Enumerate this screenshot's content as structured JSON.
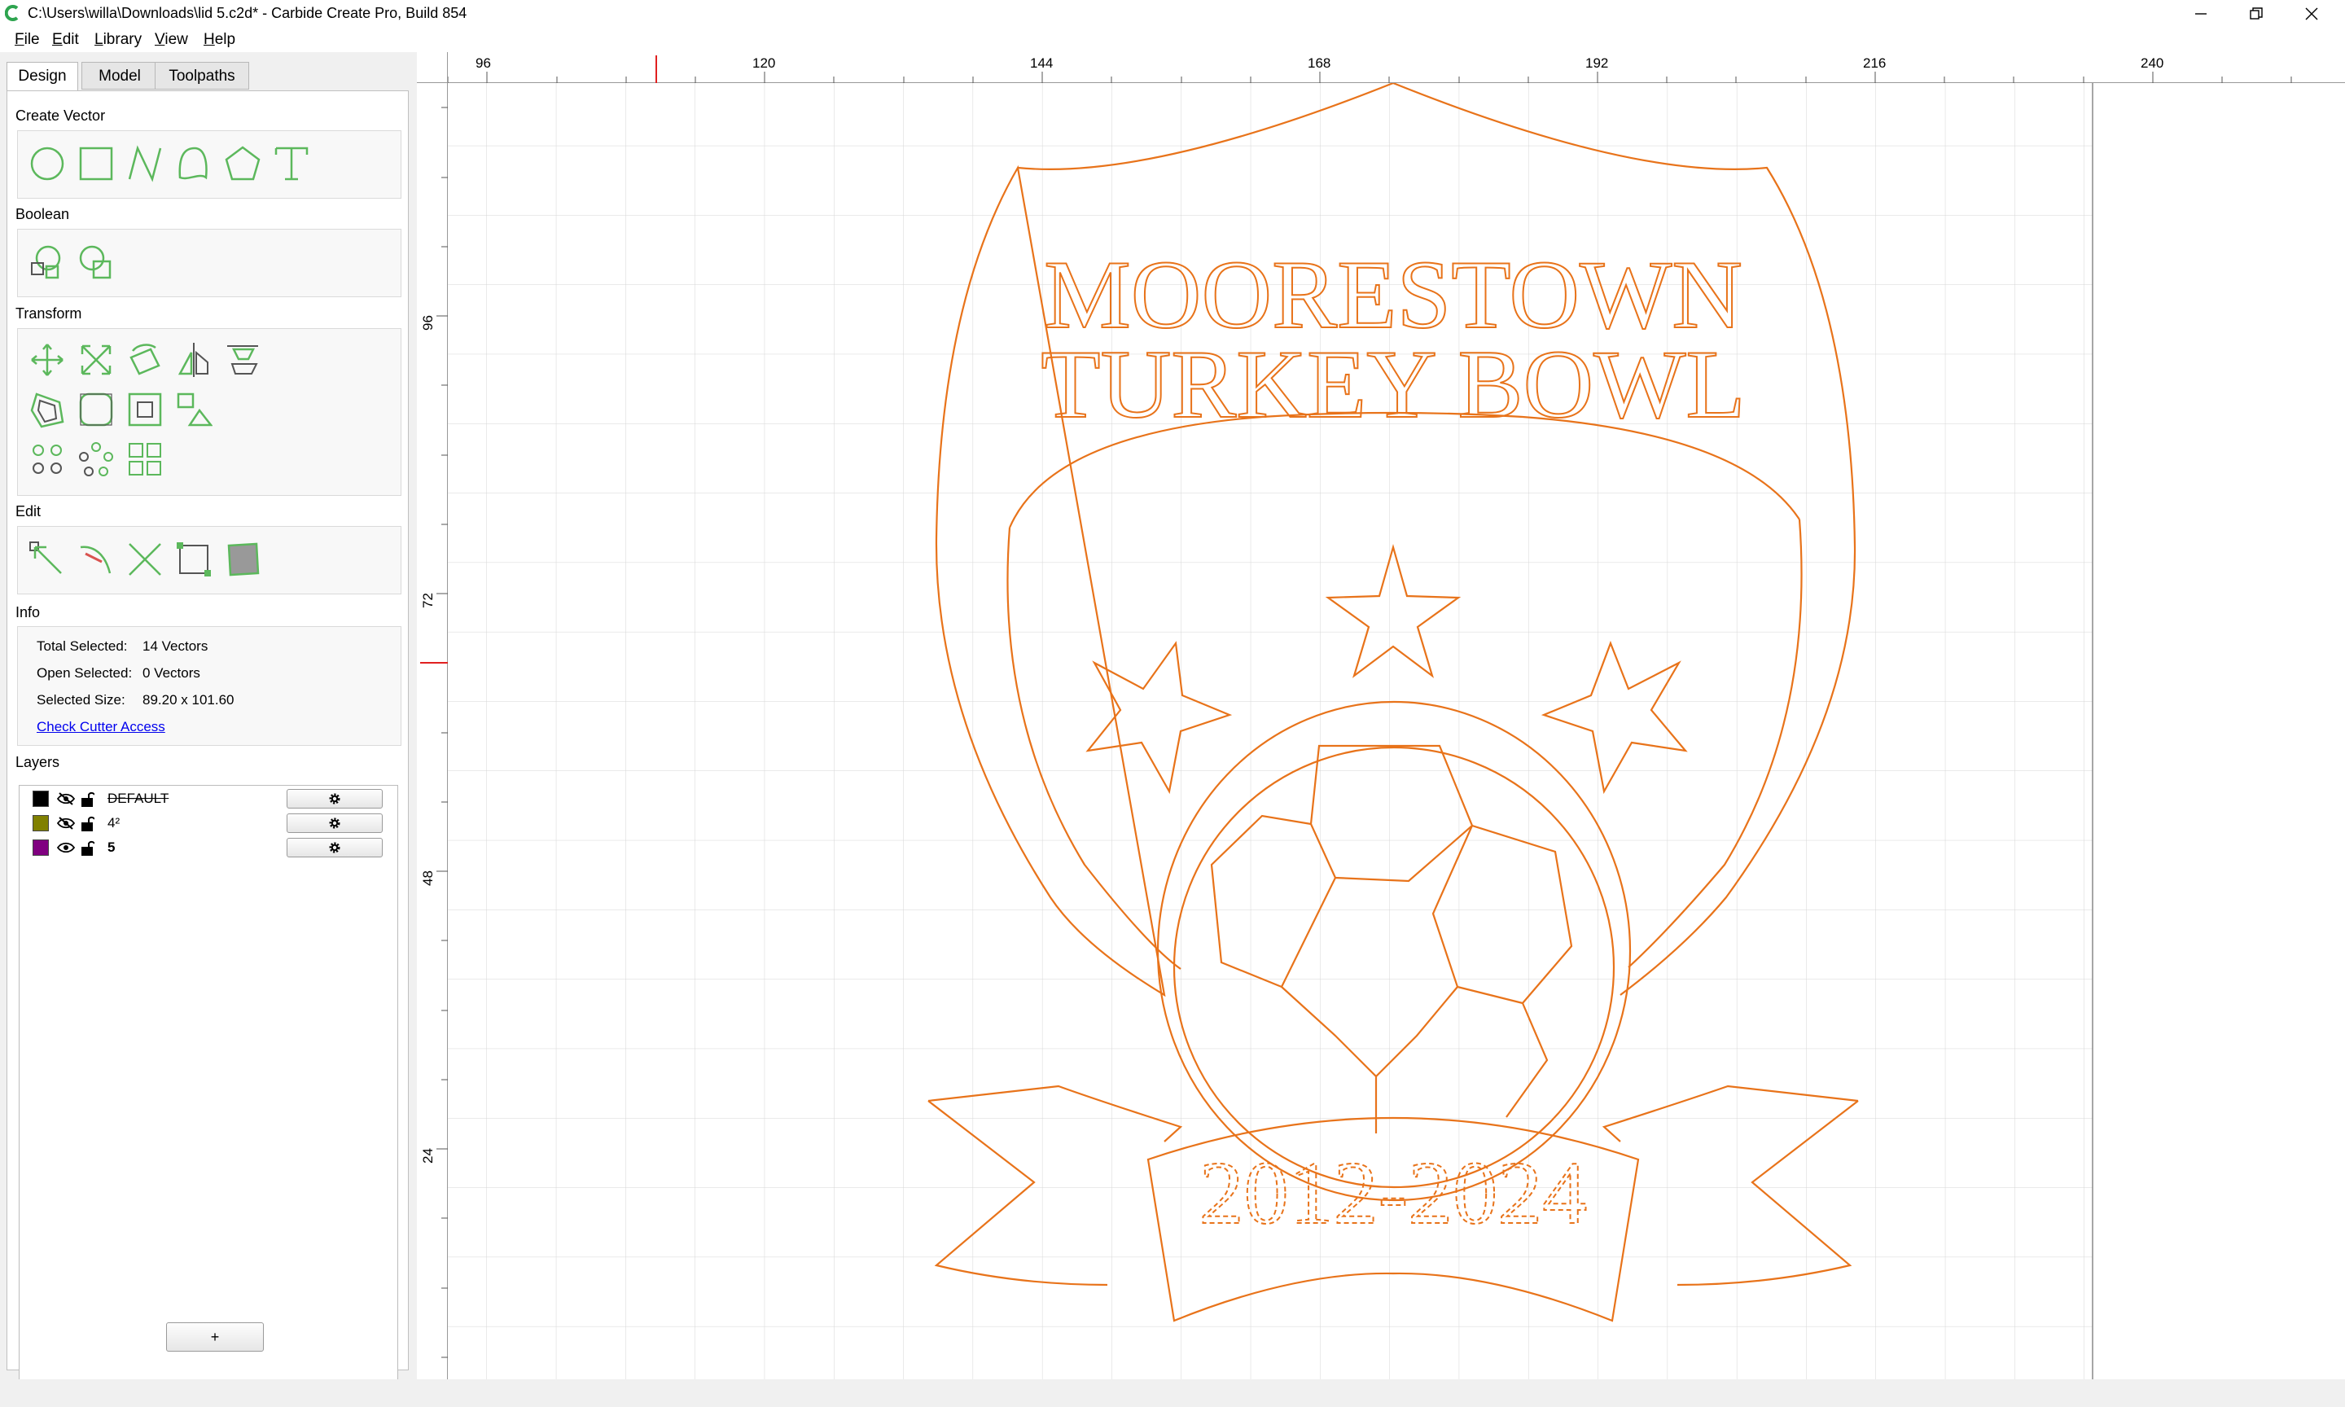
{
  "window": {
    "title": "C:\\Users\\willa\\Downloads\\lid 5.c2d* - Carbide Create Pro, Build 854",
    "controls": [
      "minimize-icon",
      "restore-icon",
      "close-icon"
    ]
  },
  "menu": {
    "items": [
      {
        "accel": "F",
        "rest": "ile"
      },
      {
        "accel": "E",
        "rest": "dit"
      },
      {
        "accel": "L",
        "rest": "ibrary"
      },
      {
        "accel": "V",
        "rest": "iew"
      },
      {
        "accel": "H",
        "rest": "elp"
      }
    ]
  },
  "tabs": [
    "Design",
    "Model",
    "Toolpaths"
  ],
  "sections": {
    "create_vector": "Create Vector",
    "boolean": "Boolean",
    "transform": "Transform",
    "edit": "Edit",
    "info": "Info",
    "layers": "Layers"
  },
  "tool_icons": {
    "create_vector": [
      "circle-icon",
      "rectangle-icon",
      "polyline-icon",
      "curve-icon",
      "polygon-icon",
      "text-icon"
    ],
    "boolean": [
      "union-icon",
      "subtract-icon"
    ],
    "transform": [
      "move-icon",
      "scale-icon",
      "rotate-icon",
      "mirror-icon",
      "align-icon",
      "offset-icon",
      "fillet-icon",
      "boundary-icon",
      "nest-icon",
      "circular-pattern-icon",
      "radial-array-icon",
      "rectangular-array-icon"
    ],
    "edit": [
      "node-edit-icon",
      "trim-icon",
      "cut-icon",
      "join-icon",
      "shape-edit-icon"
    ]
  },
  "info": {
    "total_selected_label": "Total Selected:",
    "total_selected_value": "14 Vectors",
    "open_selected_label": "Open Selected:",
    "open_selected_value": "0 Vectors",
    "selected_size_label": "Selected Size:",
    "selected_size_value": "89.20 x 101.60",
    "link": "Check Cutter Access"
  },
  "layers": [
    {
      "name": "DEFAULT",
      "color": "#000000",
      "visible": false
    },
    {
      "name": "4²",
      "color": "#808000",
      "visible": false
    },
    {
      "name": "5",
      "color": "#800080",
      "visible": true
    }
  ],
  "add_layer_label": "+",
  "ruler": {
    "h_labels": [
      "96",
      "120",
      "144",
      "168",
      "192",
      "216",
      "240"
    ],
    "v_labels": [
      "96",
      "72",
      "48",
      "24"
    ]
  },
  "design": {
    "line1": "MOORESTOWN",
    "line2": "TURKEY BOWL",
    "years": "2012-2024",
    "stroke_color": "#e8731a"
  }
}
